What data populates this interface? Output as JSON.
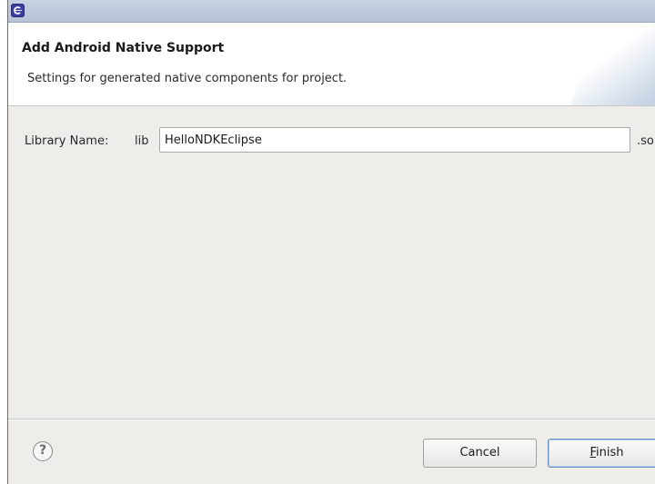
{
  "window": {
    "title": "",
    "icon": "eclipse-app-icon"
  },
  "header": {
    "title": "Add Android Native Support",
    "description": "Settings for generated native components for project."
  },
  "form": {
    "library_label": "Library Name:",
    "library_prefix": "lib",
    "library_value": "HelloNDKEclipse",
    "library_suffix": ".so"
  },
  "footer": {
    "help_icon": "?",
    "cancel_label": "Cancel",
    "finish_mnemonic": "F",
    "finish_rest": "inish"
  },
  "colors": {
    "titlebar": "#b6c2d6",
    "dialog_background": "#efedea",
    "header_background": "#ffffff",
    "default_button_border": "#6b8fc4"
  }
}
